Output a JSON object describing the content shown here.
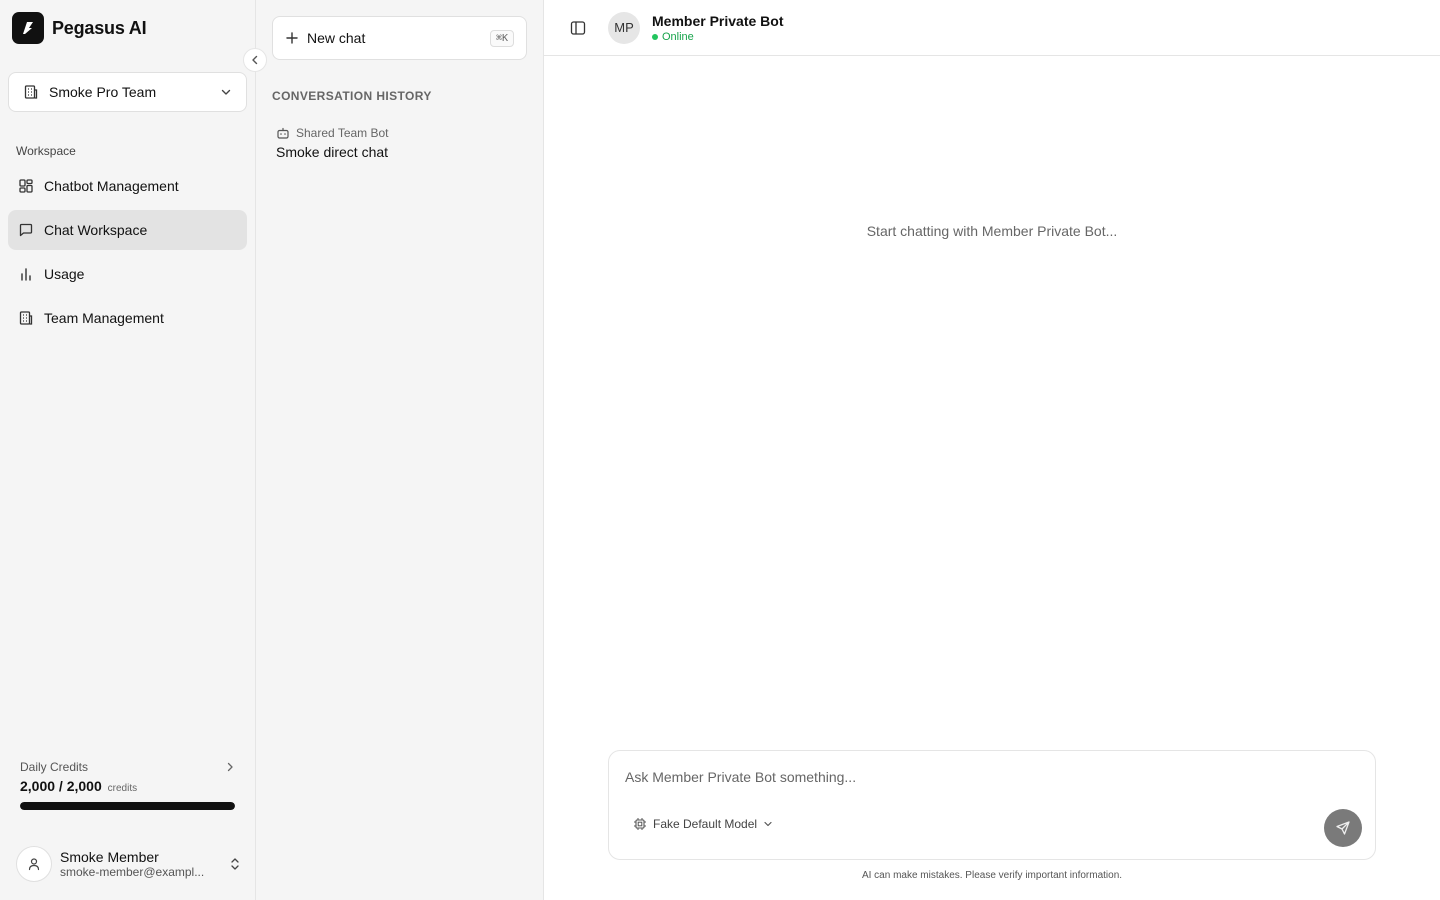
{
  "app": {
    "name": "Pegasus AI"
  },
  "team": {
    "name": "Smoke Pro Team"
  },
  "sidebar": {
    "section_label": "Workspace",
    "items": [
      {
        "label": "Chatbot Management",
        "icon": "dashboard-grid-icon"
      },
      {
        "label": "Chat Workspace",
        "icon": "message-square-icon",
        "active": true
      },
      {
        "label": "Usage",
        "icon": "bar-chart-icon"
      },
      {
        "label": "Team Management",
        "icon": "building-icon"
      }
    ]
  },
  "credits": {
    "label": "Daily Credits",
    "value": "2,000 / 2,000",
    "unit": "credits",
    "fraction": 1.0
  },
  "user": {
    "name": "Smoke Member",
    "email": "smoke-member@exampl..."
  },
  "conversations": {
    "new_chat_label": "New chat",
    "shortcut": "⌘K",
    "history_label": "CONVERSATION HISTORY",
    "items": [
      {
        "bot": "Shared Team Bot",
        "title": "Smoke direct chat"
      }
    ]
  },
  "chat": {
    "bot_initials": "MP",
    "bot_name": "Member Private Bot",
    "status": "Online",
    "empty_message": "Start chatting with Member Private Bot...",
    "input_placeholder": "Ask Member Private Bot something...",
    "model": "Fake Default Model",
    "disclaimer": "AI can make mistakes. Please verify important information."
  },
  "colors": {
    "online": "#22c55e",
    "sidebar_bg": "#f5f5f5",
    "active_nav_bg": "#e3e3e3",
    "send_button": "#7a7a7a"
  }
}
